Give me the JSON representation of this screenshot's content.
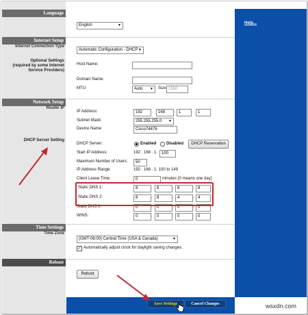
{
  "sidebar": {
    "language": "Language",
    "internet_setup": "Internet Setup",
    "internet_connection_type": "Internet Connection Type",
    "optional_settings": "Optional Settings",
    "optional_settings_2": "(required by some Internet",
    "optional_settings_3": "Service Providers)",
    "network_setup": "Network Setup",
    "router_ip": "Router IP",
    "dhcp_server_setting": "DHCP Server Setting",
    "time_settings": "Time Settings",
    "time_zone": "Time Zone",
    "reboot": "Reboot"
  },
  "language": {
    "selected": "English"
  },
  "internet": {
    "connection_type": "Automatic Configuration - DHCP",
    "host_name_label": "Host Name:",
    "host_name": "",
    "domain_name_label": "Domain Name:",
    "domain_name": "",
    "mtu_label": "MTU:",
    "mtu_mode": "Auto",
    "size_label": "Size:",
    "mtu_size": "1500"
  },
  "network": {
    "ip_label": "IP Address:",
    "ip": [
      "192",
      "168",
      "1",
      "1"
    ],
    "subnet_label": "Subnet Mask:",
    "subnet": "255.255.255.0",
    "device_label": "Device Name:",
    "device": "Cisco74476"
  },
  "dhcp": {
    "server_label": "DHCP Server:",
    "enabled": "Enabled",
    "disabled": "Disabled",
    "reservation_button": "DHCP Reservation",
    "start_ip_label": "Start IP Address:",
    "start_ip_prefix": "192 . 168 . 1.",
    "start_ip_last": "100",
    "max_users_label": "Maximum Number of Users:",
    "max_users": "50",
    "ip_range_label": "IP Address Range:",
    "ip_range": "192 . 168 . 1. 100 to 149",
    "lease_label": "Client Lease Time:",
    "lease_value": "0",
    "lease_suffix": "minutes (0 means one day)",
    "dns1_label": "Static DNS 1:",
    "dns1": [
      "8",
      "8",
      "8",
      "8"
    ],
    "dns2_label": "Static DNS 2:",
    "dns2": [
      "8",
      "8",
      "4",
      "4"
    ],
    "dns3_label": "Static DNS 3:",
    "dns3": [
      "0",
      "0",
      "0",
      "0"
    ],
    "wins_label": "WINS:",
    "wins": [
      "0",
      "0",
      "0",
      "0"
    ]
  },
  "time": {
    "zone": "(GMT-06:00) Central Time (USA & Canada)",
    "daylight_label": "Automatically adjust clock for daylight saving changes.",
    "daylight_checked": "✓"
  },
  "reboot": {
    "button": "Reboot"
  },
  "help": {
    "link": "Help..."
  },
  "actions": {
    "save": "Save Settings",
    "cancel": "Cancel Changes"
  },
  "watermark": "wsxdn.com",
  "colors": {
    "nav_blue": "#0b4fa8",
    "highlight_red": "#c0282e",
    "section_grey": "#6b6b6b"
  }
}
